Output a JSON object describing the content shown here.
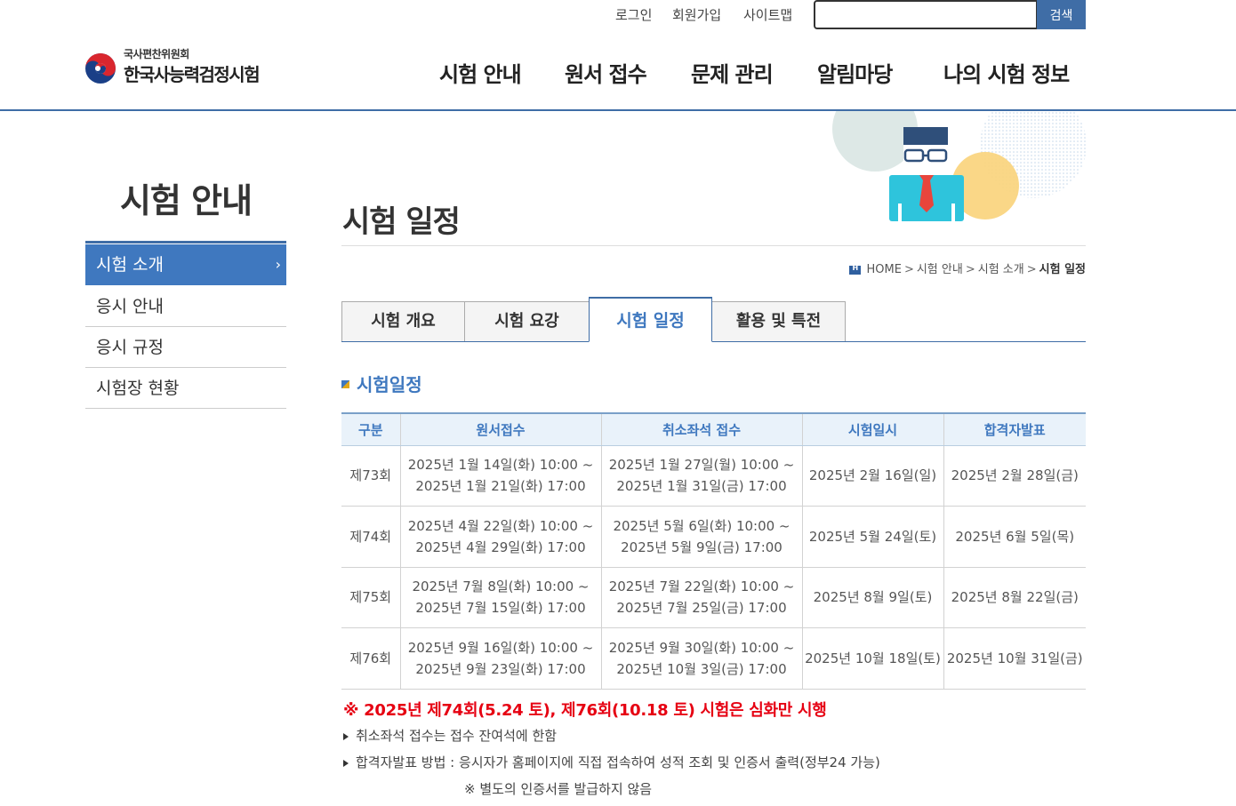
{
  "util": {
    "login": "로그인",
    "signup": "회원가입",
    "sitemap": "사이트맵",
    "search_value": "",
    "search_button": "검색"
  },
  "logo": {
    "sub": "국사편찬위원회",
    "main": "한국사능력검정시험"
  },
  "gnb": [
    "시험 안내",
    "원서 접수",
    "문제 관리",
    "알림마당",
    "나의 시험 정보"
  ],
  "lnb": {
    "title": "시험 안내",
    "items": [
      {
        "label": "시험 소개",
        "arrow": "›"
      },
      {
        "label": "응시 안내"
      },
      {
        "label": "응시 규정"
      },
      {
        "label": "시험장 현황"
      }
    ]
  },
  "page": {
    "title": "시험 일정"
  },
  "breadcrumb": [
    "HOME",
    "시험 안내",
    "시험 소개",
    "시험 일정"
  ],
  "tabs": [
    "시험 개요",
    "시험 요강",
    "시험 일정",
    "활용 및 특전"
  ],
  "section_title": "시험일정",
  "table": {
    "headers": [
      "구분",
      "원서접수",
      "취소좌석 접수",
      "시험일시",
      "합격자발표"
    ],
    "rows": [
      {
        "round": "제73회",
        "apply": [
          "2025년 1월 14일(화) 10:00 ~",
          "2025년 1월 21일(화) 17:00"
        ],
        "cancel": [
          "2025년 1월 27일(월) 10:00 ~",
          "2025년 1월 31일(금) 17:00"
        ],
        "exam": "2025년 2월 16일(일)",
        "result": "2025년 2월 28일(금)"
      },
      {
        "round": "제74회",
        "apply": [
          "2025년 4월 22일(화) 10:00 ~",
          "2025년 4월 29일(화) 17:00"
        ],
        "cancel": [
          "2025년 5월 6일(화) 10:00 ~",
          "2025년 5월 9일(금) 17:00"
        ],
        "exam": "2025년 5월 24일(토)",
        "result": "2025년 6월 5일(목)"
      },
      {
        "round": "제75회",
        "apply": [
          "2025년 7월 8일(화) 10:00 ~",
          "2025년 7월 15일(화) 17:00"
        ],
        "cancel": [
          "2025년 7월 22일(화) 10:00 ~",
          "2025년 7월 25일(금) 17:00"
        ],
        "exam": "2025년 8월 9일(토)",
        "result": "2025년 8월 22일(금)"
      },
      {
        "round": "제76회",
        "apply": [
          "2025년 9월 16일(화) 10:00 ~",
          "2025년 9월 23일(화) 17:00"
        ],
        "cancel": [
          "2025년 9월 30일(화) 10:00 ~",
          "2025년 10월 3일(금) 17:00"
        ],
        "exam": "2025년 10월 18일(토)",
        "result": "2025년 10월 31일(금)"
      }
    ]
  },
  "notices": {
    "red": "※ 2025년 제74회(5.24 토), 제76회(10.18 토) 시험은 심화만 시행",
    "note1": "취소좌석 접수는 접수 잔여석에 한함",
    "note2": "합격자발표 방법 : 응시자가 홈페이지에 직접 접속하여 성적 조회 및 인증서 출력(정부24 가능)",
    "note2_sub": "※ 별도의 인증서를 발급하지 않음"
  },
  "colors": {
    "brand_blue": "#3f6da6",
    "active_blue": "#3f78bf",
    "notice_red": "#e60012",
    "table_header_bg": "#e9f2fa"
  },
  "icons": {
    "logo_emblem": "taegeuk-icon",
    "home": "home-icon",
    "bullet": "square-bullet-icon",
    "note_marker": "triangle-bullet-icon",
    "illustration": "person-illustration"
  }
}
